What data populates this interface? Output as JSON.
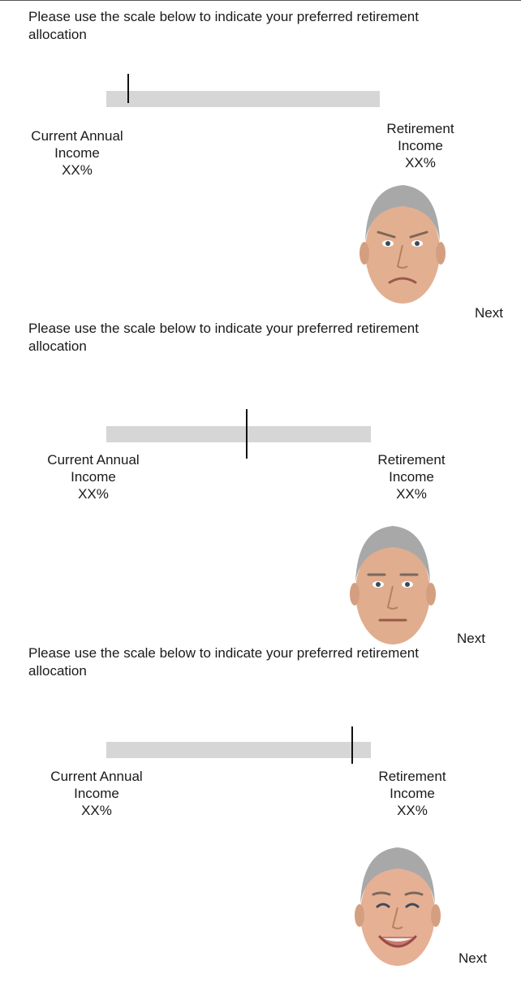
{
  "panels": [
    {
      "prompt": "Please use the scale below to indicate your preferred retirement allocation",
      "slider": {
        "position": 0.08
      },
      "left_label": {
        "line1": "Current Annual",
        "line2": "Income",
        "value": "XX%"
      },
      "right_label": {
        "line1": "Retirement",
        "line2": "Income",
        "value": "XX%"
      },
      "face": {
        "expression": "sad"
      },
      "next_label": "Next"
    },
    {
      "prompt": "Please use the scale below to indicate your preferred retirement allocation",
      "slider": {
        "position": 0.53
      },
      "left_label": {
        "line1": "Current Annual",
        "line2": "Income",
        "value": "XX%"
      },
      "right_label": {
        "line1": "Retirement",
        "line2": "Income",
        "value": "XX%"
      },
      "face": {
        "expression": "neutral"
      },
      "next_label": "Next"
    },
    {
      "prompt": "Please use the scale below to indicate your preferred retirement allocation",
      "slider": {
        "position": 0.93
      },
      "left_label": {
        "line1": "Current Annual",
        "line2": "Income",
        "value": "XX%"
      },
      "right_label": {
        "line1": "Retirement",
        "line2": "Income",
        "value": "XX%"
      },
      "face": {
        "expression": "happy"
      },
      "next_label": "Next"
    }
  ]
}
